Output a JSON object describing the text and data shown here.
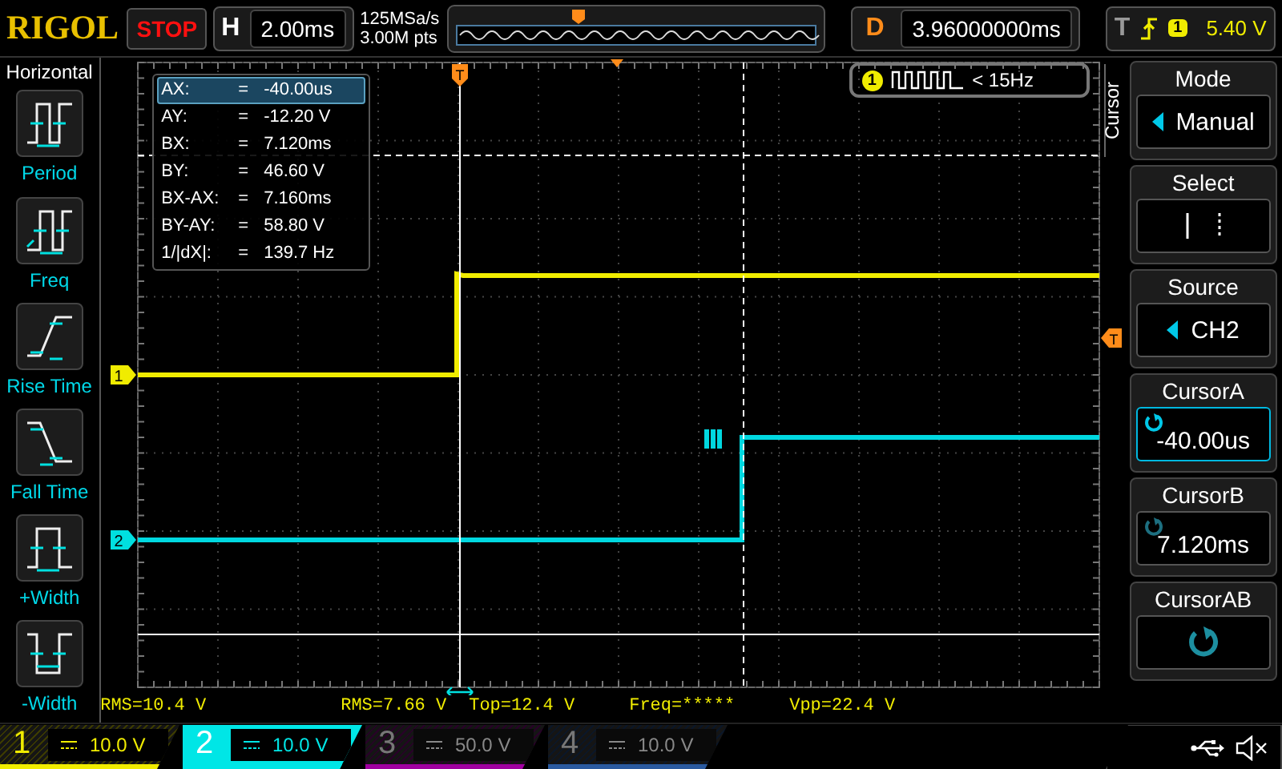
{
  "top_bar": {
    "logo": "RIGOL",
    "run_state": "STOP",
    "horizontal": {
      "label": "H",
      "value": "2.00ms"
    },
    "sample_rate": "125MSa/s",
    "memory_depth": "3.00M pts",
    "delay": {
      "label": "D",
      "value": "3.96000000ms"
    },
    "trigger": {
      "label": "T",
      "channel": "1",
      "level": "5.40 V"
    }
  },
  "left_menu": {
    "title": "Horizontal",
    "items": [
      {
        "label": "Period",
        "kind": "period"
      },
      {
        "label": "Freq",
        "kind": "freq"
      },
      {
        "label": "Rise Time",
        "kind": "rise"
      },
      {
        "label": "Fall Time",
        "kind": "fall"
      },
      {
        "label": "+Width",
        "kind": "pwidth"
      },
      {
        "label": "-Width",
        "kind": "nwidth"
      }
    ]
  },
  "cursor_readout": [
    {
      "label": "AX:",
      "eq": "=",
      "value": "-40.00us",
      "selected": true
    },
    {
      "label": "AY:",
      "eq": "=",
      "value": "-12.20 V",
      "selected": false
    },
    {
      "label": "BX:",
      "eq": "=",
      "value": "7.120ms",
      "selected": false
    },
    {
      "label": "BY:",
      "eq": "=",
      "value": "46.60 V",
      "selected": false
    },
    {
      "label": "BX-AX:",
      "eq": "=",
      "value": "7.160ms",
      "selected": false
    },
    {
      "label": "BY-AY:",
      "eq": "=",
      "value": "58.80 V",
      "selected": false
    },
    {
      "label": "1/|dX|:",
      "eq": "=",
      "value": "139.7 Hz",
      "selected": false
    }
  ],
  "frequency_counter": {
    "channel": "1",
    "value": "< 15Hz"
  },
  "plot_markers": {
    "channel_1": "1",
    "channel_2": "2",
    "trigger_top": "T",
    "trigger_right": "T"
  },
  "measurements": [
    "RMS=10.4 V",
    "RMS=7.66 V",
    "Top=12.4 V",
    "Freq=*****",
    "Vpp=22.4 V"
  ],
  "right_menu": {
    "tab": "Cursor",
    "items": [
      {
        "title": "Mode",
        "kind": "choice",
        "value": "Manual",
        "selected": false
      },
      {
        "title": "Select",
        "kind": "select",
        "selected": false
      },
      {
        "title": "Source",
        "kind": "choice",
        "value": "CH2",
        "selected": false
      },
      {
        "title": "CursorA",
        "kind": "knob",
        "value": "-40.00us",
        "selected": true
      },
      {
        "title": "CursorB",
        "kind": "knob",
        "value": "7.120ms",
        "selected": false
      },
      {
        "title": "CursorAB",
        "kind": "knob_only",
        "selected": false
      }
    ]
  },
  "channels": [
    {
      "number": "1",
      "scale": "10.0 V",
      "on": true,
      "selected": false,
      "color": "#f0ec00"
    },
    {
      "number": "2",
      "scale": "10.0 V",
      "on": true,
      "selected": true,
      "color": "#00e6e6"
    },
    {
      "number": "3",
      "scale": "50.0 V",
      "on": false,
      "selected": false,
      "color": "#a000a0"
    },
    {
      "number": "4",
      "scale": "10.0 V",
      "on": false,
      "selected": false,
      "color": "#2a5aa0"
    }
  ]
}
